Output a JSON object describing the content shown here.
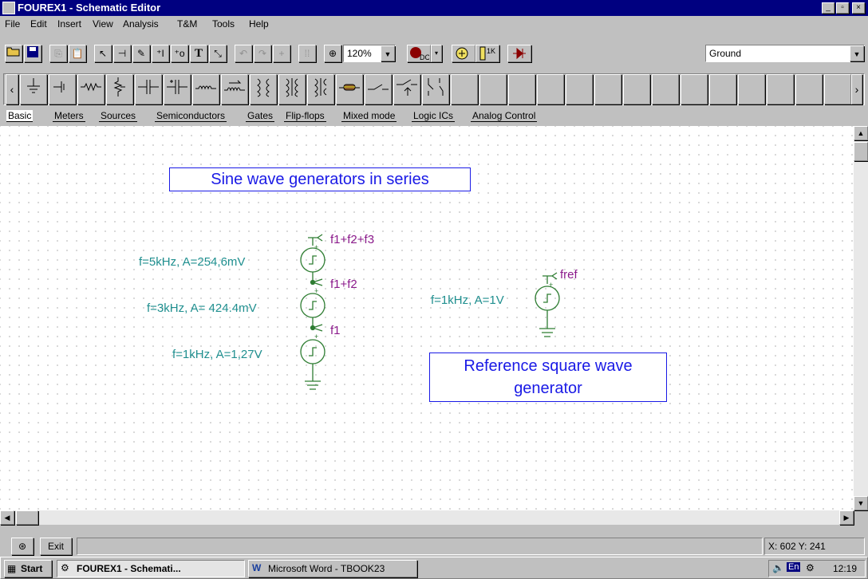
{
  "window": {
    "title": "FOUREX1 - Schematic Editor",
    "controls": [
      "_",
      "▫",
      "×"
    ]
  },
  "menu": [
    "File",
    "Edit",
    "Insert",
    "View",
    "Analysis",
    "T&M",
    "Tools",
    "Help"
  ],
  "toolbar": {
    "zoom": "120%",
    "ground_combo": "Ground",
    "buttons": [
      "open-icon",
      "save-icon",
      "copy-icon",
      "paste-icon",
      "pointer-icon",
      "wire-icon",
      "pencil-icon",
      "text-insert-icon",
      "text-origin-icon",
      "text-icon",
      "label-icon",
      "undo-icon",
      "redo-icon",
      "snap-icon",
      "grid-icon",
      "zoom-icon",
      "dc-analysis-icon",
      "meter-icon",
      "resistance-meter-icon",
      "diode-icon"
    ],
    "labels": {
      "text_T": "T",
      "dc": "DC",
      "onek": "1K"
    }
  },
  "components": [
    "ground-icon",
    "battery-icon",
    "resistor-icon",
    "potentiometer-icon",
    "capacitor-icon",
    "polarized-capacitor-icon",
    "inductor-icon",
    "variable-inductor-icon",
    "transformer-icon",
    "transformer2-icon",
    "transformer3-icon",
    "fuse-icon",
    "switch-icon",
    "relay-icon",
    "coupled-switch-icon"
  ],
  "tabs": [
    "Basic",
    "Meters",
    "Sources",
    "Semiconductors",
    "Gates",
    "Flip-flops",
    "Mixed mode",
    "Logic ICs",
    "Analog Control"
  ],
  "schematic": {
    "title_box": "Sine wave generators in series",
    "ref_box_line1": "Reference square wave",
    "ref_box_line2": "generator",
    "gen1": "f=5kHz, A=254,6mV",
    "gen2": "f=3kHz, A= 424.4mV",
    "gen3": "f=1kHz, A=1,27V",
    "gen_ref": "f=1kHz, A=1V",
    "node_top": "f1+f2+f3",
    "node_mid": "f1+f2",
    "node_low": "f1",
    "node_ref": "fref"
  },
  "status": {
    "exit": "Exit",
    "coords": "X: 602 Y: 241"
  },
  "taskbar": {
    "start": "Start",
    "task1": "FOUREX1 - Schemati...",
    "task2": "Microsoft Word - TBOOK23",
    "lang": "En",
    "time": "12:19"
  },
  "colors": {
    "title": "#000080",
    "label_blue": "#1a1ae6",
    "component_green": "#2e7d32",
    "annotation_teal": "#1f8f8f",
    "node_purple": "#8b1a8b"
  }
}
